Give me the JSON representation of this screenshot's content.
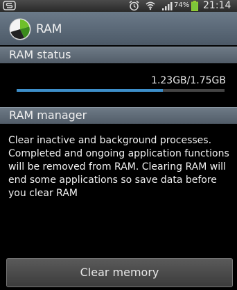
{
  "status_bar": {
    "battery_percent": "74%",
    "time": "21:14",
    "icons": [
      "notification-s-icon",
      "alarm-icon",
      "wifi-icon",
      "signal-icon",
      "battery-icon"
    ]
  },
  "app": {
    "title": "RAM"
  },
  "ram_status": {
    "header": "RAM status",
    "usage": "1.23GB/1.75GB",
    "used_fraction": 0.703
  },
  "ram_manager": {
    "header": "RAM manager",
    "description": "Clear inactive and background processes.\nCompleted and ongoing application functions\nwill be removed from RAM. Clearing RAM will\nend some applications so save data before\nyou clear RAM"
  },
  "actions": {
    "clear_memory_label": "Clear memory"
  },
  "colors": {
    "accent_bar": "#3d8ec9",
    "header_bg": "#5f6b78"
  }
}
